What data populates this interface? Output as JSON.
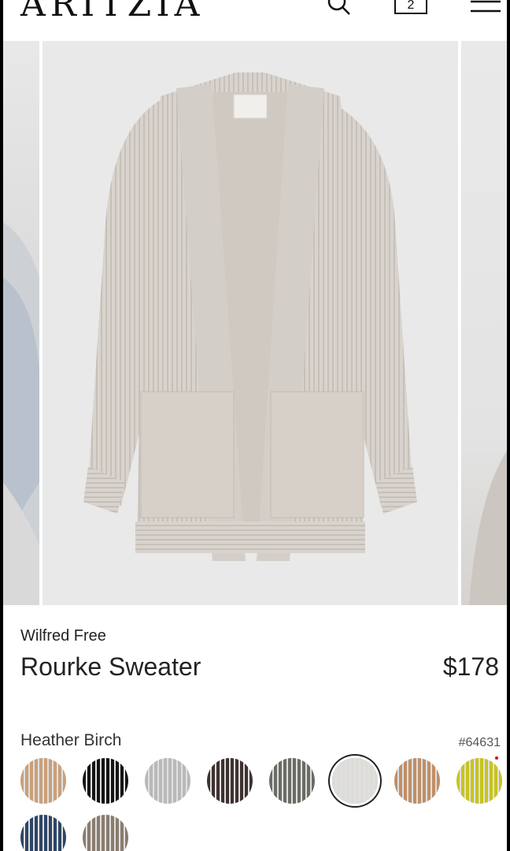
{
  "header": {
    "logo": "ARITZIA",
    "bag_count": "2"
  },
  "product": {
    "brand": "Wilfred Free",
    "name": "Rourke Sweater",
    "price": "$178",
    "selected_color": "Heather Birch",
    "style_number": "#64631"
  },
  "swatches": [
    {
      "color": "#c9a07a",
      "selected": false
    },
    {
      "color": "#151515",
      "selected": false
    },
    {
      "color": "#b9b9b9",
      "selected": false
    },
    {
      "color": "#3e3230",
      "selected": false
    },
    {
      "color": "#6b6c63",
      "selected": false
    },
    {
      "color": "#dedcd8",
      "selected": true
    },
    {
      "color": "#c08f67",
      "selected": false
    },
    {
      "color": "#c7c41e",
      "selected": false
    },
    {
      "color": "#2e4566",
      "selected": false
    },
    {
      "color": "#8b7c6e",
      "selected": false
    }
  ],
  "icons": {
    "search": "search-icon",
    "bag": "shopping-bag-icon",
    "menu": "hamburger-menu-icon"
  }
}
